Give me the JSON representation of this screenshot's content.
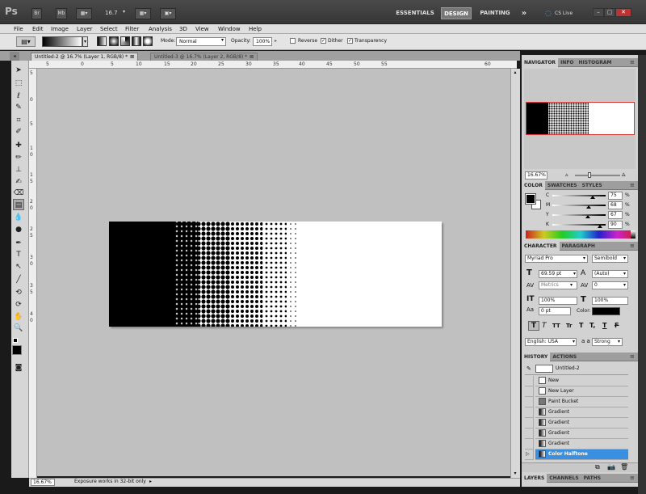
{
  "app": {
    "logo": "Ps",
    "bridge": "Br",
    "mini_bridge": "Mb",
    "zoom_value": "16.7",
    "workspaces": [
      "ESSENTIALS",
      "DESIGN",
      "PAINTING"
    ],
    "more": "»",
    "cs_live": "CS Live",
    "window_buttons": [
      "–",
      "▢",
      "✕"
    ]
  },
  "menu": [
    "File",
    "Edit",
    "Image",
    "Layer",
    "Select",
    "Filter",
    "Analysis",
    "3D",
    "View",
    "Window",
    "Help"
  ],
  "options": {
    "mode_label": "Mode:",
    "mode_value": "Normal",
    "opacity_label": "Opacity:",
    "opacity_value": "100%",
    "reverse_label": "Reverse",
    "reverse_checked": false,
    "dither_label": "Dither",
    "dither_checked": true,
    "transparency_label": "Transparency",
    "transparency_checked": true
  },
  "tabs": [
    {
      "label": "Untitled-2 @ 16.7% (Layer 1, RGB/8) *",
      "close": "⊠"
    },
    {
      "label": "Untitled-3 @ 16.7% (Layer 2, RGB/8) *",
      "close": "⊠"
    }
  ],
  "ruler": {
    "h": [
      "5",
      "0",
      "5",
      "10",
      "15",
      "20",
      "25",
      "30",
      "35",
      "40",
      "45",
      "50",
      "55",
      "60"
    ],
    "v": [
      "5",
      "0",
      "5",
      "1",
      "0",
      "1",
      "5",
      "2",
      "0",
      "2",
      "5",
      "3",
      "0",
      "3",
      "5",
      "4",
      "0"
    ]
  },
  "status": {
    "zoom": "16.67%",
    "message": "Exposure works in 32-bit only"
  },
  "navigator": {
    "tabs": [
      "NAVIGATOR",
      "INFO",
      "HISTOGRAM"
    ],
    "zoom": "16.67%"
  },
  "color": {
    "tabs": [
      "COLOR",
      "SWATCHES",
      "STYLES"
    ],
    "channels": [
      {
        "label": "C",
        "value": "75",
        "unit": "%",
        "level": 0.75
      },
      {
        "label": "M",
        "value": "68",
        "unit": "%",
        "level": 0.68
      },
      {
        "label": "Y",
        "value": "67",
        "unit": "%",
        "level": 0.67
      },
      {
        "label": "K",
        "value": "90",
        "unit": "%",
        "level": 0.9
      }
    ]
  },
  "character": {
    "tabs": [
      "CHARACTER",
      "PARAGRAPH"
    ],
    "font_family": "Myriad Pro",
    "font_style": "Semibold",
    "size": "69.59 pt",
    "leading": "(Auto)",
    "kerning": "Metrics",
    "tracking": "0",
    "vscale": "100%",
    "hscale": "100%",
    "baseline": "0 pt",
    "color_label": "Color:",
    "styles": [
      "T",
      "T",
      "TT",
      "Tr",
      "T",
      "T,",
      "T",
      "F"
    ],
    "language": "English: USA",
    "aa_label": "a a",
    "antialias": "Strong"
  },
  "history": {
    "tabs": [
      "HISTORY",
      "ACTIONS"
    ],
    "snapshot": "Untitled-2",
    "items": [
      "New",
      "New Layer",
      "Paint Bucket",
      "Gradient",
      "Gradient",
      "Gradient",
      "Gradient",
      "Color Halftone"
    ],
    "selected_index": 7
  },
  "bottom_tabs": [
    "LAYERS",
    "CHANNELS",
    "PATHS"
  ],
  "colors": {
    "accent": "#3a8fe0",
    "spectrum_red": "#cc2222"
  }
}
